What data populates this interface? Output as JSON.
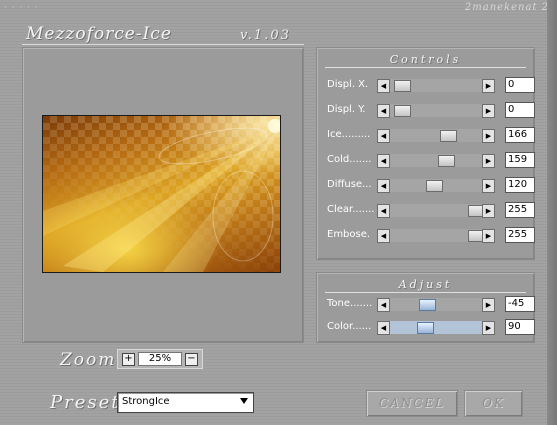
{
  "top": {
    "dots": "· · · · ·",
    "brand": "2manekenat 2"
  },
  "app": {
    "title": "Mezzoforce-Ice",
    "version": "v.1.03"
  },
  "controls": {
    "title": "Controls",
    "sliders": [
      {
        "label": "Displ. X.",
        "value": "0",
        "level": 0.06
      },
      {
        "label": "Displ. Y.",
        "value": "0",
        "level": 0.06
      },
      {
        "label": "Ice.........",
        "value": "166",
        "level": 0.65
      },
      {
        "label": "Cold.......",
        "value": "159",
        "level": 0.62
      },
      {
        "label": "Diffuse...",
        "value": "120",
        "level": 0.47
      },
      {
        "label": "Clear.......",
        "value": "255",
        "level": 1.0
      },
      {
        "label": "Embose.",
        "value": "255",
        "level": 1.0
      }
    ]
  },
  "adjust": {
    "title": "Adjust",
    "sliders": [
      {
        "label": "Tone.......",
        "value": "-45",
        "level": 0.38
      },
      {
        "label": "Color......",
        "value": "90",
        "level": 0.35
      }
    ]
  },
  "zoom": {
    "label": "Zoom",
    "value": "25%",
    "plus": "+",
    "minus": "−"
  },
  "preset": {
    "label": "Preset",
    "value": "StrongIce"
  },
  "buttons": {
    "cancel": "CANCEL",
    "ok": "OK"
  },
  "icons": {
    "left": "◀",
    "right": "▶"
  }
}
